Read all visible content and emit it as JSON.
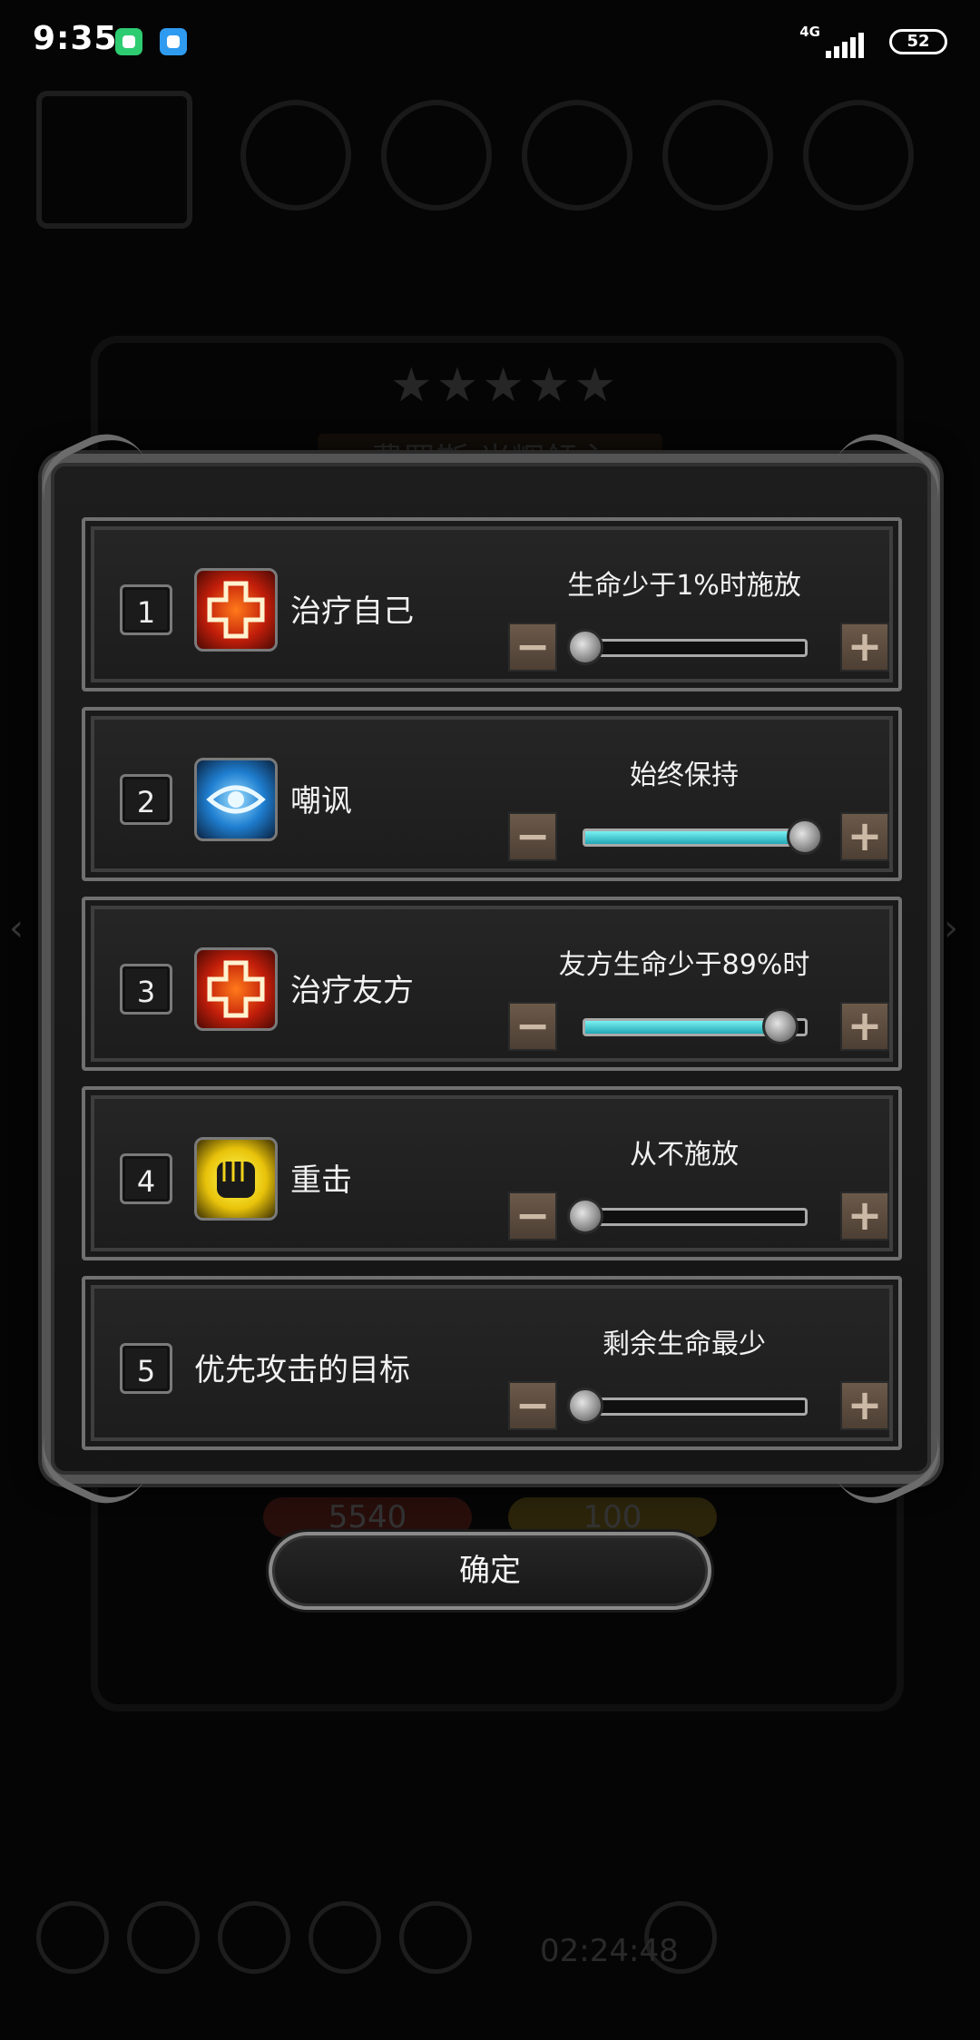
{
  "status_bar": {
    "time": "9:35",
    "network": "4G",
    "battery": "52"
  },
  "background": {
    "stars": "★★★★★",
    "hero_name": "费罗斯·光辉领主",
    "hp_value": "5540",
    "energy_value": "100",
    "timer": "02:24:48"
  },
  "rows": [
    {
      "index": "1",
      "icon": "heal-cross-icon",
      "label": "治疗自己",
      "condition": "生命少于1%时施放",
      "level": 0.0
    },
    {
      "index": "2",
      "icon": "taunt-eye-icon",
      "label": "嘲讽",
      "condition": "始终保持",
      "level": 1.0
    },
    {
      "index": "3",
      "icon": "heal-cross-icon",
      "label": "治疗友方",
      "condition": "友方生命少于89%时",
      "level": 0.89
    },
    {
      "index": "4",
      "icon": "fist-icon",
      "label": "重击",
      "condition": "从不施放",
      "level": 0.0
    },
    {
      "index": "5",
      "icon": "",
      "label": "优先攻击的目标",
      "condition": "剩余生命最少",
      "level": 0.0
    }
  ],
  "stepper": {
    "minus": "−",
    "plus": "+"
  },
  "confirm_label": "确定",
  "colors": {
    "slider_fill": "#3cc8d2",
    "heal_icon": "#e2340f",
    "taunt_icon": "#2a8ee0",
    "strike_icon": "#f0d21a"
  }
}
